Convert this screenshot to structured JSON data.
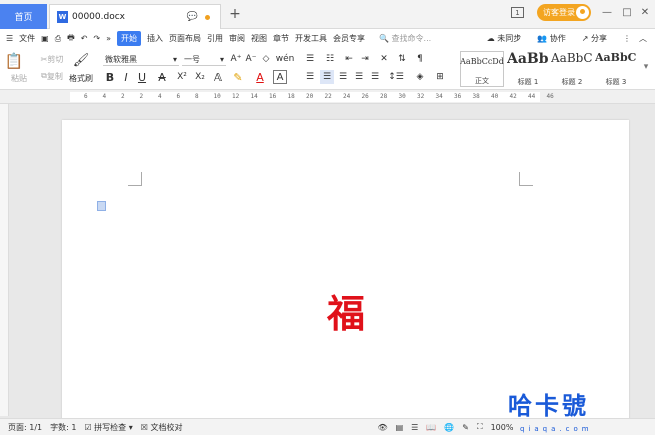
{
  "titlebar": {
    "home_tab": "首页",
    "doc_icon": "W",
    "doc_tab": "00000.docx",
    "new_tab": "+",
    "window_box": "1",
    "login": "访客登录",
    "minimize": "—",
    "maximize": "□",
    "close": "✕"
  },
  "menubar": {
    "file": "文件",
    "items": [
      "开始",
      "插入",
      "页面布局",
      "引用",
      "审阅",
      "视图",
      "章节",
      "开发工具",
      "会员专享"
    ],
    "search": "查找命令...",
    "sync": "未同步",
    "collab": "协作",
    "share": "分享"
  },
  "toolbar": {
    "paste": "粘贴",
    "cut": "剪切",
    "copy": "复制",
    "format_painter": "格式刷",
    "font_name": "微软雅黑",
    "font_size": "一号",
    "bold": "B",
    "italic": "I",
    "underline": "U",
    "strike": "A",
    "superscript": "X²",
    "subscript": "X₂",
    "styles": [
      {
        "sample": "AaBbCcDd",
        "label": "正文"
      },
      {
        "sample": "AaBb",
        "label": "标题 1"
      },
      {
        "sample": "AaBbC",
        "label": "标题 2"
      },
      {
        "sample": "AaBbC",
        "label": "标题 3"
      }
    ]
  },
  "ruler": {
    "numbers": [
      "6",
      "4",
      "2",
      "2",
      "4",
      "6",
      "8",
      "10",
      "12",
      "14",
      "16",
      "18",
      "20",
      "22",
      "24",
      "26",
      "28",
      "30",
      "32",
      "34",
      "36",
      "38",
      "40",
      "42",
      "44",
      "46"
    ]
  },
  "document": {
    "content": "福",
    "content_color": "#e0111a"
  },
  "statusbar": {
    "page": "页面: 1/1",
    "words": "字数: 1",
    "spell": "拼写检查",
    "proof": "文档校对",
    "zoom": "100%"
  },
  "watermark": {
    "text": "哈卡號",
    "sub": "qiaqa.com"
  },
  "colors": {
    "accent": "#3b7cf0",
    "home_tab": "#4b82f0",
    "login": "#f3a521"
  }
}
